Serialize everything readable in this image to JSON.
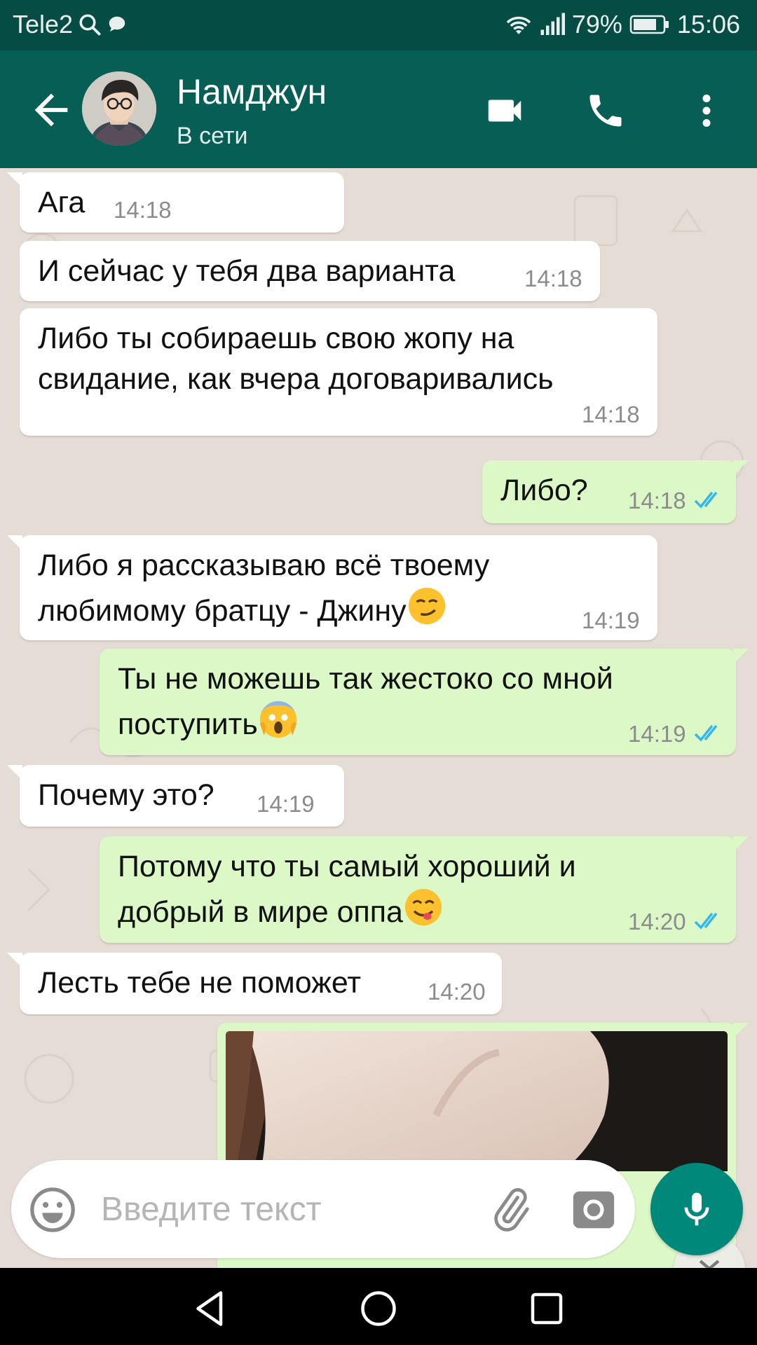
{
  "status_bar": {
    "carrier": "Tele2",
    "battery": "79%",
    "time": "15:06",
    "icons": [
      "search-icon",
      "chat-bubble-icon",
      "wifi-icon",
      "signal-icon",
      "battery-icon"
    ]
  },
  "header": {
    "contact_name": "Намджун",
    "contact_status": "В сети",
    "icons": [
      "back-arrow-icon",
      "video-call-icon",
      "phone-icon",
      "more-vert-icon"
    ]
  },
  "messages": [
    {
      "direction": "in",
      "text": "Ага",
      "time": "14:18"
    },
    {
      "direction": "in",
      "text": "И сейчас у тебя два варианта",
      "time": "14:18"
    },
    {
      "direction": "in",
      "lines": [
        "Либо ты собираешь свою жопу на",
        "свидание, как вчера договаривались"
      ],
      "time": "14:18"
    },
    {
      "direction": "out",
      "text": "Либо?",
      "time": "14:18",
      "status": "read"
    },
    {
      "direction": "in",
      "lines": [
        "Либо я рассказываю всё твоему",
        "любимому братцу - Джину"
      ],
      "emoji": "smirking-face",
      "time": "14:19"
    },
    {
      "direction": "out",
      "lines": [
        "Ты не можешь так жестоко со мной",
        "поступить"
      ],
      "emoji": "face-screaming-in-fear",
      "time": "14:19",
      "status": "read"
    },
    {
      "direction": "in",
      "text": "Почему это?",
      "time": "14:19"
    },
    {
      "direction": "out",
      "lines": [
        "Потому что ты самый хороший и",
        "добрый в мире оппа"
      ],
      "emoji": "face-savoring-food",
      "time": "14:20",
      "status": "read"
    },
    {
      "direction": "in",
      "text": "Лесть тебе не поможет",
      "time": "14:20"
    },
    {
      "direction": "out",
      "type": "image"
    }
  ],
  "composer": {
    "placeholder": "Введите текст",
    "icons": [
      "emoji-icon",
      "attach-icon",
      "camera-icon",
      "mic-icon"
    ]
  },
  "nav_bar": {
    "icons": [
      "nav-back-icon",
      "nav-home-icon",
      "nav-recents-icon"
    ]
  },
  "colors": {
    "status_bar": "#054d44",
    "app_bar": "#075e54",
    "chat_background": "#e5ddd5",
    "incoming_bubble": "#ffffff",
    "outgoing_bubble": "#dcf8c6",
    "read_ticks": "#34b7f1",
    "mic_button": "#00897b"
  }
}
